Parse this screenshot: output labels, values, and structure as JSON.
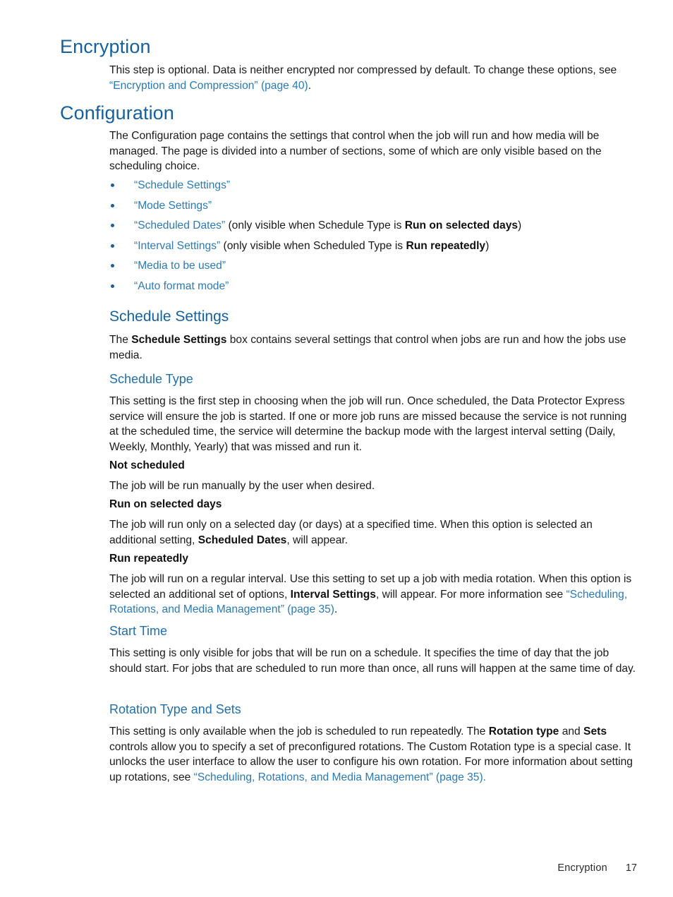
{
  "document": {
    "sections": [
      {
        "id": "encryption",
        "heading": "Encryption",
        "paragraph": {
          "pre": "This step is optional. Data is neither encrypted nor compressed by default. To change these options, see ",
          "link": "“Encryption and Compression” (page 40)",
          "post": "."
        }
      },
      {
        "id": "configuration",
        "heading": "Configuration",
        "intro": "The Configuration page contains the settings that control when the job will run and how media will be managed. The page is divided into a number of sections, some of which are only visible based on the scheduling choice.",
        "bullets": [
          {
            "link": "“Schedule Settings”",
            "rest_pre": "",
            "bold": "",
            "rest_post": ""
          },
          {
            "link": "“Mode Settings”",
            "rest_pre": "",
            "bold": "",
            "rest_post": ""
          },
          {
            "link": "“Scheduled Dates”",
            "rest_pre": " (only visible when Schedule Type is ",
            "bold": "Run on selected days",
            "rest_post": ")"
          },
          {
            "link": "“Interval Settings”",
            "rest_pre": " (only visible when Scheduled Type is ",
            "bold": "Run repeatedly",
            "rest_post": ")"
          },
          {
            "link": "“Media to be used”",
            "rest_pre": "",
            "bold": "",
            "rest_post": ""
          },
          {
            "link": "“Auto format mode”",
            "rest_pre": "",
            "bold": "",
            "rest_post": ""
          }
        ]
      }
    ],
    "schedule_settings": {
      "heading": "Schedule Settings",
      "intro_pre": "The ",
      "intro_bold": "Schedule Settings",
      "intro_post": " box contains several settings that control when jobs are run and how the jobs use media."
    },
    "schedule_type": {
      "heading": "Schedule Type",
      "paragraph": "This setting is the first step in choosing when the job will run. Once scheduled, the Data Protector Express service will ensure the job is started. If one or more job runs are missed because the service is not running at the scheduled time, the service will determine the backup mode with the largest interval setting (Daily, Weekly, Monthly, Yearly) that was missed and run it.",
      "options": [
        {
          "title": "Not scheduled",
          "pre": "The job will be run manually by the user when desired.",
          "bold": "",
          "post": ""
        },
        {
          "title": "Run on selected days",
          "pre": "The job will run only on a selected day (or days) at a specified time. When this option is selected an additional setting, ",
          "bold": "Scheduled Dates",
          "post": ", will appear."
        },
        {
          "title": "Run repeatedly",
          "pre": "The job will run on a regular interval. Use this setting to set up a job with media rotation. When this option is selected an additional set of options, ",
          "bold": "Interval Settings",
          "post": ", will appear. For more information see ",
          "link": "“Scheduling, Rotations, and Media Management” (page 35)",
          "tail": "."
        }
      ]
    },
    "start_time": {
      "heading": "Start Time",
      "paragraph": "This setting is only visible for jobs that will be run on a schedule. It specifies the time of day that the job should start. For jobs that are scheduled to run more than once, all runs will happen at the same time of day."
    },
    "rotation": {
      "heading": "Rotation Type and Sets",
      "p_pre": "This setting is only available when the job is scheduled to run repeatedly. The ",
      "p_bold1": "Rotation type",
      "p_mid1": " and ",
      "p_bold2": "Sets",
      "p_mid2": " controls allow you to specify a set of preconfigured rotations. The Custom Rotation type is a special case. It unlocks the user interface to allow the user to configure his own rotation. For more information about setting up rotations, see ",
      "p_link": "“Scheduling, Rotations, and Media Management” (page 35).",
      "p_post": ""
    },
    "footer": {
      "name": "Encryption",
      "page": "17"
    },
    "colors": {
      "heading_primary": "#15619f",
      "heading_tertiary": "#2170ad",
      "link": "#2a7ab9",
      "bullet": "#1b5f9e",
      "body": "#1a1a1a",
      "background": "#ffffff"
    }
  }
}
